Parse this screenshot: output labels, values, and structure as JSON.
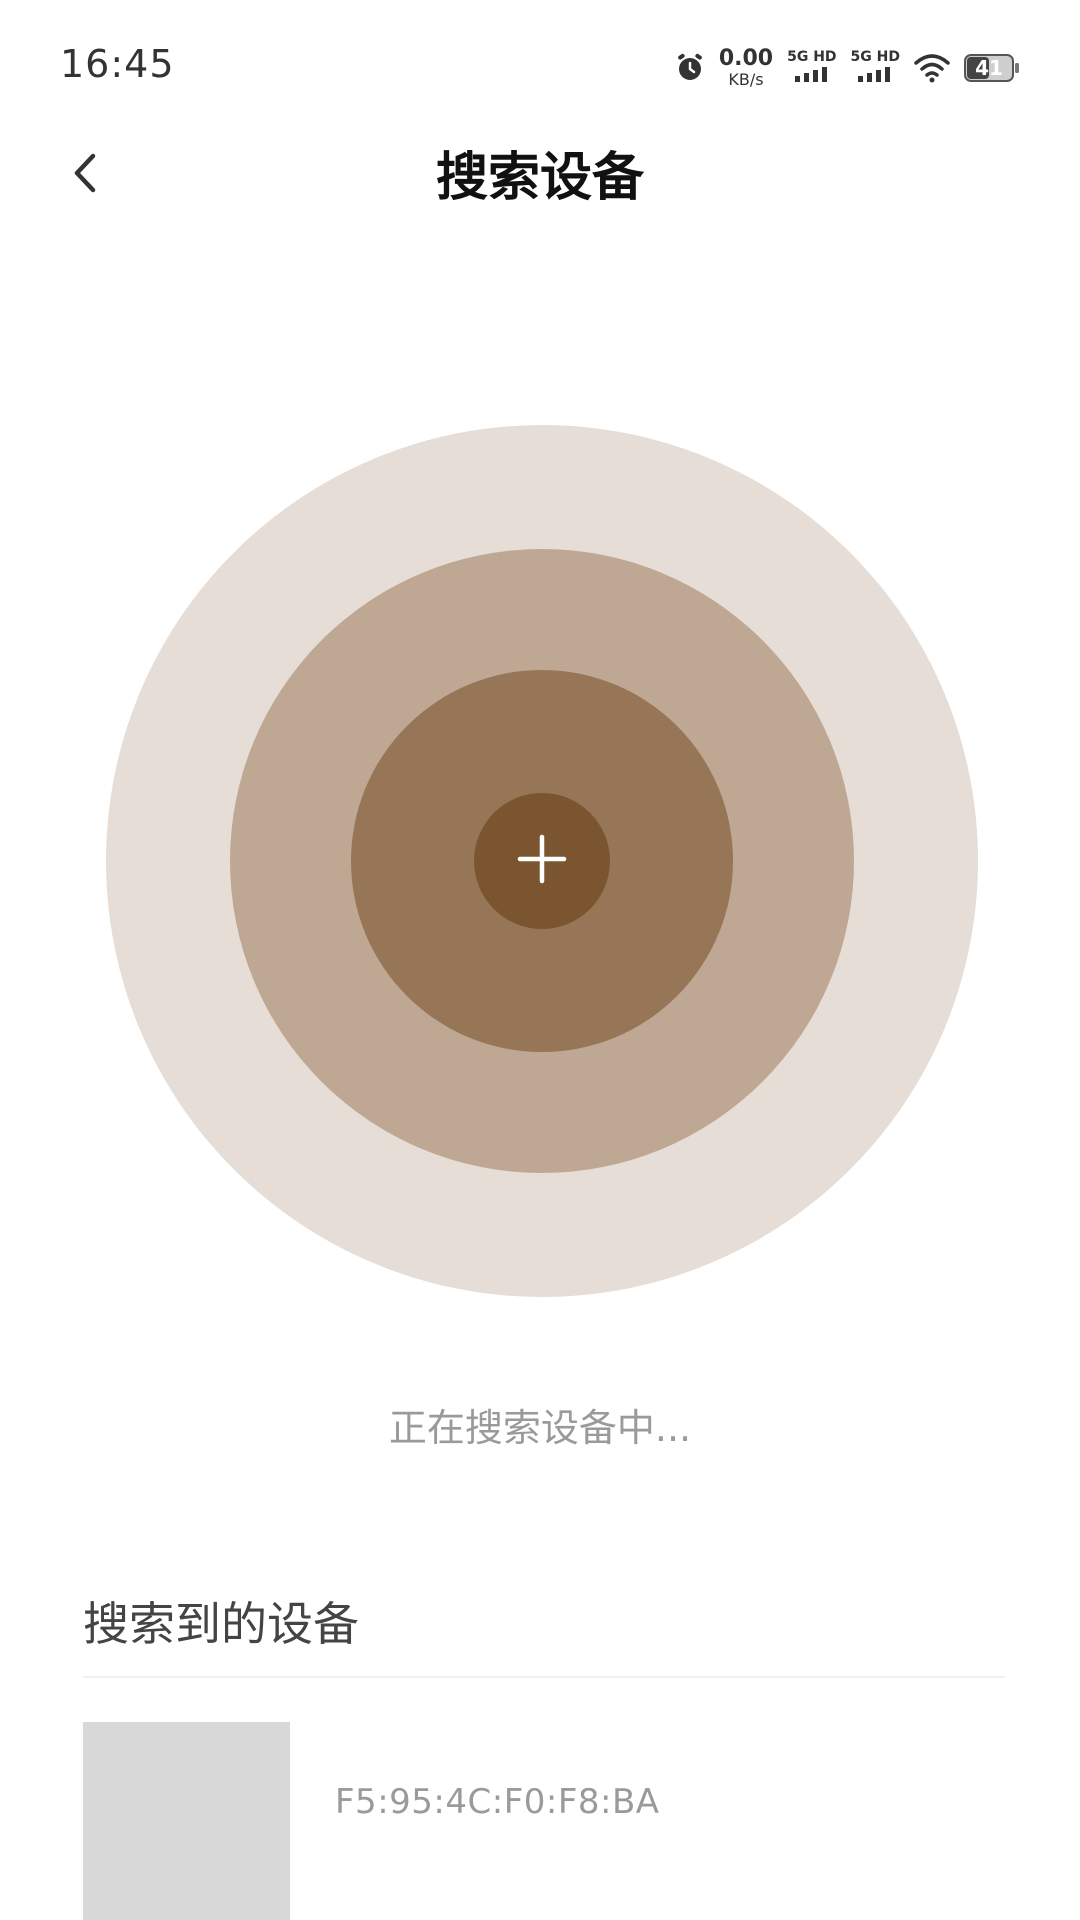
{
  "status_bar": {
    "time": "16:45",
    "net_speed_value": "0.00",
    "net_speed_unit": "KB/s",
    "sim1_label": "5G HD",
    "sim2_label": "5G HD",
    "battery_level": "41",
    "icons": [
      "alarm-icon",
      "signal-icon",
      "wifi-icon",
      "battery-icon"
    ]
  },
  "header": {
    "title": "搜索设备",
    "back_icon": "chevron-left-icon"
  },
  "radar": {
    "center_icon": "plus-icon",
    "colors": [
      "#e5ddd6",
      "#bfa893",
      "#967656",
      "#7b5530"
    ]
  },
  "searching_text": "正在搜索设备中...",
  "found_section": {
    "title": "搜索到的设备",
    "devices": [
      {
        "mac": "F5:95:4C:F0:F8:BA"
      }
    ]
  }
}
